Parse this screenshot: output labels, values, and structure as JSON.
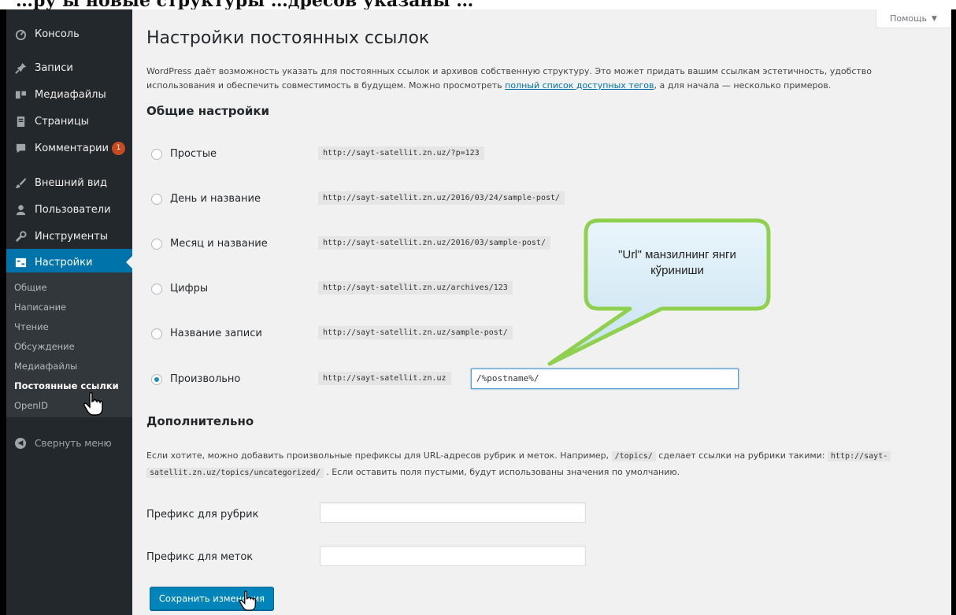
{
  "top_strip_text": "…ру ы новые структуры  …дресов указаны  …",
  "sidebar": {
    "items": [
      {
        "icon": "dashboard-icon",
        "label": "Консоль"
      },
      {
        "icon": "pin-icon",
        "label": "Записи"
      },
      {
        "icon": "media-icon",
        "label": "Медиафайлы"
      },
      {
        "icon": "pages-icon",
        "label": "Страницы"
      },
      {
        "icon": "comments-icon",
        "label": "Комментарии",
        "badge": "1"
      },
      {
        "icon": "appearance-icon",
        "label": "Внешний вид"
      },
      {
        "icon": "users-icon",
        "label": "Пользователи"
      },
      {
        "icon": "tools-icon",
        "label": "Инструменты"
      },
      {
        "icon": "settings-icon",
        "label": "Настройки"
      }
    ],
    "submenu": [
      "Общие",
      "Написание",
      "Чтение",
      "Обсуждение",
      "Медиафайлы",
      "Постоянные ссылки",
      "OpenID"
    ],
    "collapse_label": "Свернуть меню"
  },
  "help_tab": "Помощь",
  "page": {
    "title": "Настройки постоянных ссылок",
    "intro_before_link": "WordPress даёт возможность указать для постоянных ссылок и архивов собственную структуру. Это может придать вашим ссылкам эстетичность, удобство использования и обеспечить совместимость в будущем. Можно просмотреть ",
    "intro_link": "полный список доступных тегов",
    "intro_after_link": ", а для начала — несколько примеров.",
    "common_settings_title": "Общие настройки",
    "options": [
      {
        "label": "Простые",
        "example": "http://sayt-satellit.zn.uz/?p=123",
        "checked": false
      },
      {
        "label": "День и название",
        "example": "http://sayt-satellit.zn.uz/2016/03/24/sample-post/",
        "checked": false
      },
      {
        "label": "Месяц и название",
        "example": "http://sayt-satellit.zn.uz/2016/03/sample-post/",
        "checked": false
      },
      {
        "label": "Цифры",
        "example": "http://sayt-satellit.zn.uz/archives/123",
        "checked": false
      },
      {
        "label": "Название записи",
        "example": "http://sayt-satellit.zn.uz/sample-post/",
        "checked": false
      },
      {
        "label": "Произвольно",
        "example": "http://sayt-satellit.zn.uz",
        "checked": true,
        "structure_value": "/%postname%/"
      }
    ],
    "optional_title": "Дополнительно",
    "optional_text_1": "Если хотите, можно добавить произвольные префиксы для URL-адресов рубрик и меток. Например, ",
    "optional_code_1": "/topics/",
    "optional_text_2": " сделает ссылки на рубрики такими: ",
    "optional_code_2a": "http://sayt-",
    "optional_code_2b": "satellit.zn.uz/topics/uncategorized/",
    "optional_text_3": " . Если оставить поля пустыми, будут использованы значения по умолчанию.",
    "category_base_label": "Префикс для рубрик",
    "category_base_value": "",
    "tag_base_label": "Префикс для меток",
    "tag_base_value": "",
    "save_button": "Сохранить изменения"
  },
  "callout": {
    "line1": "\"Url\" манзилнинг янги",
    "line2": "кўриниши",
    "color_fill": "#d6ecf7",
    "color_border": "#8fd14f"
  },
  "colors": {
    "sidebar_bg": "#23282d",
    "submenu_bg": "#32373c",
    "accent": "#0073aa",
    "button": "#0085ba"
  }
}
